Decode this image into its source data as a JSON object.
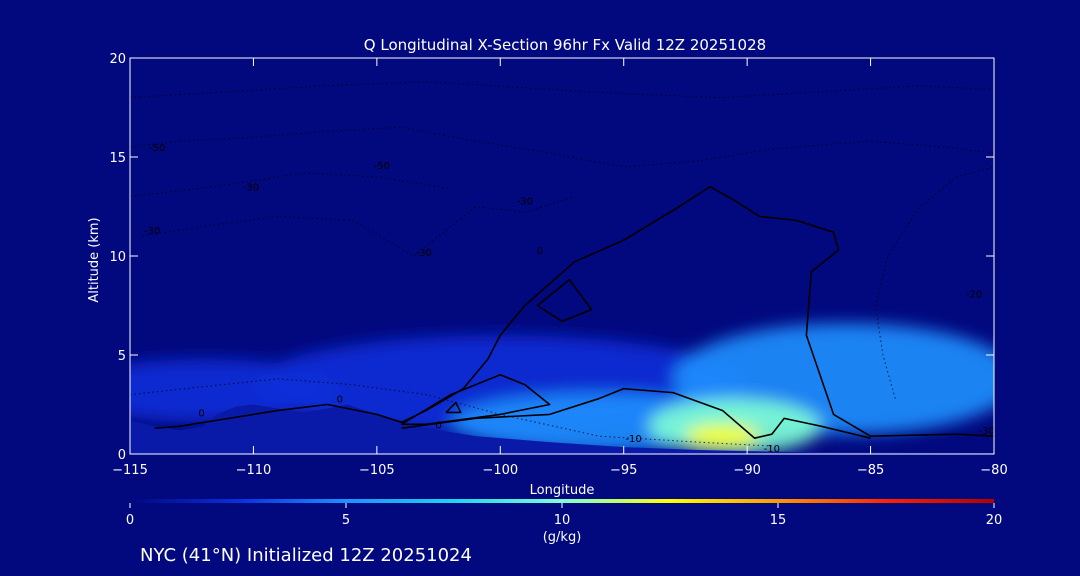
{
  "chart_data": {
    "type": "heatmap",
    "title": "Q Longitudinal X-Section 96hr  Fx Valid 12Z 20251028",
    "xlabel": "Longitude",
    "ylabel": "Altitude (km)",
    "xlim": [
      -115,
      -80
    ],
    "ylim": [
      0,
      20
    ],
    "xticks": [
      -115,
      -110,
      -105,
      -100,
      -95,
      -90,
      -85,
      -80
    ],
    "yticks": [
      0,
      5,
      10,
      15,
      20
    ],
    "grid": false,
    "colorbar": {
      "label": "(g/kg)",
      "range": [
        0,
        20
      ],
      "ticks": [
        0,
        5,
        10,
        15,
        20
      ],
      "colors": [
        "#02087e",
        "#0a2fd9",
        "#1e90ff",
        "#22d3ee",
        "#7fffd4",
        "#ffff00",
        "#ff9900",
        "#ff2200",
        "#b00000"
      ]
    },
    "background_color": "#02087e",
    "terrain_color": "#0a1aa8",
    "terrain": [
      {
        "x": -115,
        "y": 1.7
      },
      {
        "x": -114,
        "y": 1.4
      },
      {
        "x": -113,
        "y": 1.2
      },
      {
        "x": -112,
        "y": 1.4
      },
      {
        "x": -111.5,
        "y": 2.0
      },
      {
        "x": -110.7,
        "y": 2.4
      },
      {
        "x": -110,
        "y": 2.5
      },
      {
        "x": -109,
        "y": 2.3
      },
      {
        "x": -108,
        "y": 2.1
      },
      {
        "x": -107,
        "y": 2.3
      },
      {
        "x": -106.2,
        "y": 2.5
      },
      {
        "x": -105,
        "y": 2.0
      },
      {
        "x": -103,
        "y": 1.3
      },
      {
        "x": -101,
        "y": 0.9
      },
      {
        "x": -98,
        "y": 0.6
      },
      {
        "x": -95,
        "y": 0.35
      },
      {
        "x": -92,
        "y": 0.2
      },
      {
        "x": -88,
        "y": 0.1
      },
      {
        "x": -80,
        "y": 0.05
      }
    ],
    "moisture_blobs": [
      {
        "x": -112,
        "y": 3.2,
        "rx": 5.5,
        "ry": 1.6,
        "value": 2.5
      },
      {
        "x": -100,
        "y": 3.5,
        "rx": 10,
        "ry": 2.5,
        "value": 3
      },
      {
        "x": -86,
        "y": 3.8,
        "rx": 7,
        "ry": 2.8,
        "value": 4
      },
      {
        "x": -96,
        "y": 1.6,
        "rx": 6,
        "ry": 1.5,
        "value": 5
      },
      {
        "x": -90.5,
        "y": 1.4,
        "rx": 3.5,
        "ry": 1.4,
        "value": 9
      },
      {
        "x": -91,
        "y": 0.9,
        "rx": 1.5,
        "ry": 0.6,
        "value": 12
      }
    ],
    "contours": [
      {
        "level": "0",
        "style": "solid",
        "points": [
          [
            -114,
            1.3
          ],
          [
            -113,
            1.4
          ],
          [
            -111,
            1.8
          ],
          [
            -109,
            2.2
          ],
          [
            -107,
            2.5
          ],
          [
            -105,
            2.0
          ],
          [
            -104,
            1.6
          ],
          [
            -103,
            2.2
          ],
          [
            -101.5,
            3.3
          ],
          [
            -100.5,
            4.8
          ],
          [
            -100,
            6.0
          ],
          [
            -99,
            7.5
          ],
          [
            -97,
            9.7
          ],
          [
            -95,
            10.8
          ],
          [
            -93,
            12.3
          ],
          [
            -91.5,
            13.5
          ],
          [
            -90.5,
            12.8
          ],
          [
            -89.5,
            12.0
          ],
          [
            -88,
            11.8
          ],
          [
            -86.5,
            11.2
          ],
          [
            -86.3,
            10.3
          ],
          [
            -87.4,
            9.2
          ],
          [
            -87.6,
            6.0
          ],
          [
            -86.5,
            2.0
          ],
          [
            -85,
            0.9
          ],
          [
            -81.5,
            1.0
          ],
          [
            -80,
            0.9
          ]
        ]
      },
      {
        "level": "0",
        "style": "solid",
        "points": [
          [
            -104,
            1.5
          ],
          [
            -102,
            3.0
          ],
          [
            -100,
            4.0
          ],
          [
            -99,
            3.5
          ],
          [
            -98,
            2.5
          ],
          [
            -100,
            2.0
          ],
          [
            -103,
            1.5
          ],
          [
            -104,
            1.5
          ]
        ]
      },
      {
        "level": "0",
        "style": "solid",
        "points": [
          [
            -104,
            1.3
          ],
          [
            -101,
            1.8
          ],
          [
            -98,
            2.0
          ],
          [
            -96,
            2.8
          ],
          [
            -95,
            3.3
          ],
          [
            -93,
            3.1
          ],
          [
            -91,
            2.2
          ],
          [
            -89.7,
            0.8
          ],
          [
            -89,
            1.0
          ],
          [
            -88.5,
            1.8
          ],
          [
            -87,
            1.4
          ],
          [
            -85,
            0.8
          ]
        ]
      },
      {
        "level": "0",
        "style": "solid",
        "points": [
          [
            -98.5,
            7.5
          ],
          [
            -97.2,
            8.8
          ],
          [
            -96.3,
            7.3
          ],
          [
            -97.5,
            6.7
          ],
          [
            -98.5,
            7.5
          ]
        ]
      },
      {
        "level": "0",
        "style": "solid",
        "points": [
          [
            -102.2,
            2.1
          ],
          [
            -101.8,
            2.6
          ],
          [
            -101.6,
            2.1
          ],
          [
            -102.2,
            2.1
          ]
        ]
      },
      {
        "level": "-10",
        "style": "dotted",
        "points": [
          [
            -115,
            3.0
          ],
          [
            -112,
            3.4
          ],
          [
            -109,
            3.8
          ],
          [
            -106,
            3.5
          ],
          [
            -103,
            3.0
          ],
          [
            -100,
            2.0
          ],
          [
            -96,
            0.9
          ],
          [
            -92,
            0.6
          ],
          [
            -89,
            0.4
          ]
        ]
      },
      {
        "level": "-30",
        "style": "dotted",
        "points": [
          [
            -114.5,
            11.0
          ],
          [
            -112,
            11.5
          ],
          [
            -109,
            12.0
          ],
          [
            -106,
            11.8
          ],
          [
            -103.5,
            10.0
          ],
          [
            -101,
            12.5
          ],
          [
            -99,
            12.2
          ],
          [
            -97,
            13.0
          ]
        ]
      },
      {
        "level": "-50",
        "style": "dotted",
        "points": [
          [
            -115,
            15.5
          ],
          [
            -113,
            15.8
          ],
          [
            -110,
            16.0
          ],
          [
            -107,
            16.3
          ],
          [
            -104,
            16.5
          ],
          [
            -101,
            15.8
          ],
          [
            -98,
            15.2
          ],
          [
            -95,
            14.5
          ],
          [
            -92,
            14.8
          ],
          [
            -89,
            15.4
          ],
          [
            -85,
            15.8
          ],
          [
            -82,
            15.5
          ],
          [
            -80,
            15.2
          ]
        ]
      },
      {
        "level": "-60",
        "style": "dotted",
        "points": [
          [
            -115,
            18.0
          ],
          [
            -111,
            18.3
          ],
          [
            -107,
            18.6
          ],
          [
            -103,
            18.8
          ],
          [
            -99,
            18.5
          ],
          [
            -95,
            18.2
          ],
          [
            -91,
            18.0
          ],
          [
            -87,
            18.3
          ],
          [
            -83,
            18.6
          ],
          [
            -80,
            18.4
          ]
        ]
      },
      {
        "level": "-20",
        "style": "dotted",
        "points": [
          [
            -84,
            2.8
          ],
          [
            -84.5,
            5.0
          ],
          [
            -84.8,
            7.5
          ],
          [
            -84.3,
            10.0
          ],
          [
            -83,
            12.5
          ],
          [
            -81.5,
            14.0
          ],
          [
            -80,
            14.5
          ]
        ]
      },
      {
        "level": "-40",
        "style": "dotted",
        "points": [
          [
            -115,
            13.0
          ],
          [
            -111,
            13.6
          ],
          [
            -108,
            14.2
          ],
          [
            -105,
            14.0
          ],
          [
            -102,
            13.4
          ]
        ]
      }
    ],
    "contour_labels": [
      {
        "text": "0",
        "x": -112.1,
        "y": 1.9
      },
      {
        "text": "0",
        "x": -106.5,
        "y": 2.6
      },
      {
        "text": "0",
        "x": -102.5,
        "y": 1.3
      },
      {
        "text": "0",
        "x": -98.4,
        "y": 10.1
      },
      {
        "text": "-10",
        "x": -94.6,
        "y": 0.6
      },
      {
        "text": "-10",
        "x": -89.0,
        "y": 0.1
      },
      {
        "text": "-30",
        "x": -114.1,
        "y": 11.1
      },
      {
        "text": "-30",
        "x": -110.1,
        "y": 13.3
      },
      {
        "text": "-50",
        "x": -113.9,
        "y": 15.3
      },
      {
        "text": "-50",
        "x": -104.8,
        "y": 14.4
      },
      {
        "text": "-30",
        "x": -103.1,
        "y": 10.0
      },
      {
        "text": "-30",
        "x": -99.0,
        "y": 12.6
      },
      {
        "text": "-20",
        "x": -80.8,
        "y": 7.9
      },
      {
        "text": "-30",
        "x": -80.3,
        "y": 1.0
      }
    ]
  },
  "footer": {
    "station": "NYC (41°N) Initialized 12Z 20251024"
  }
}
